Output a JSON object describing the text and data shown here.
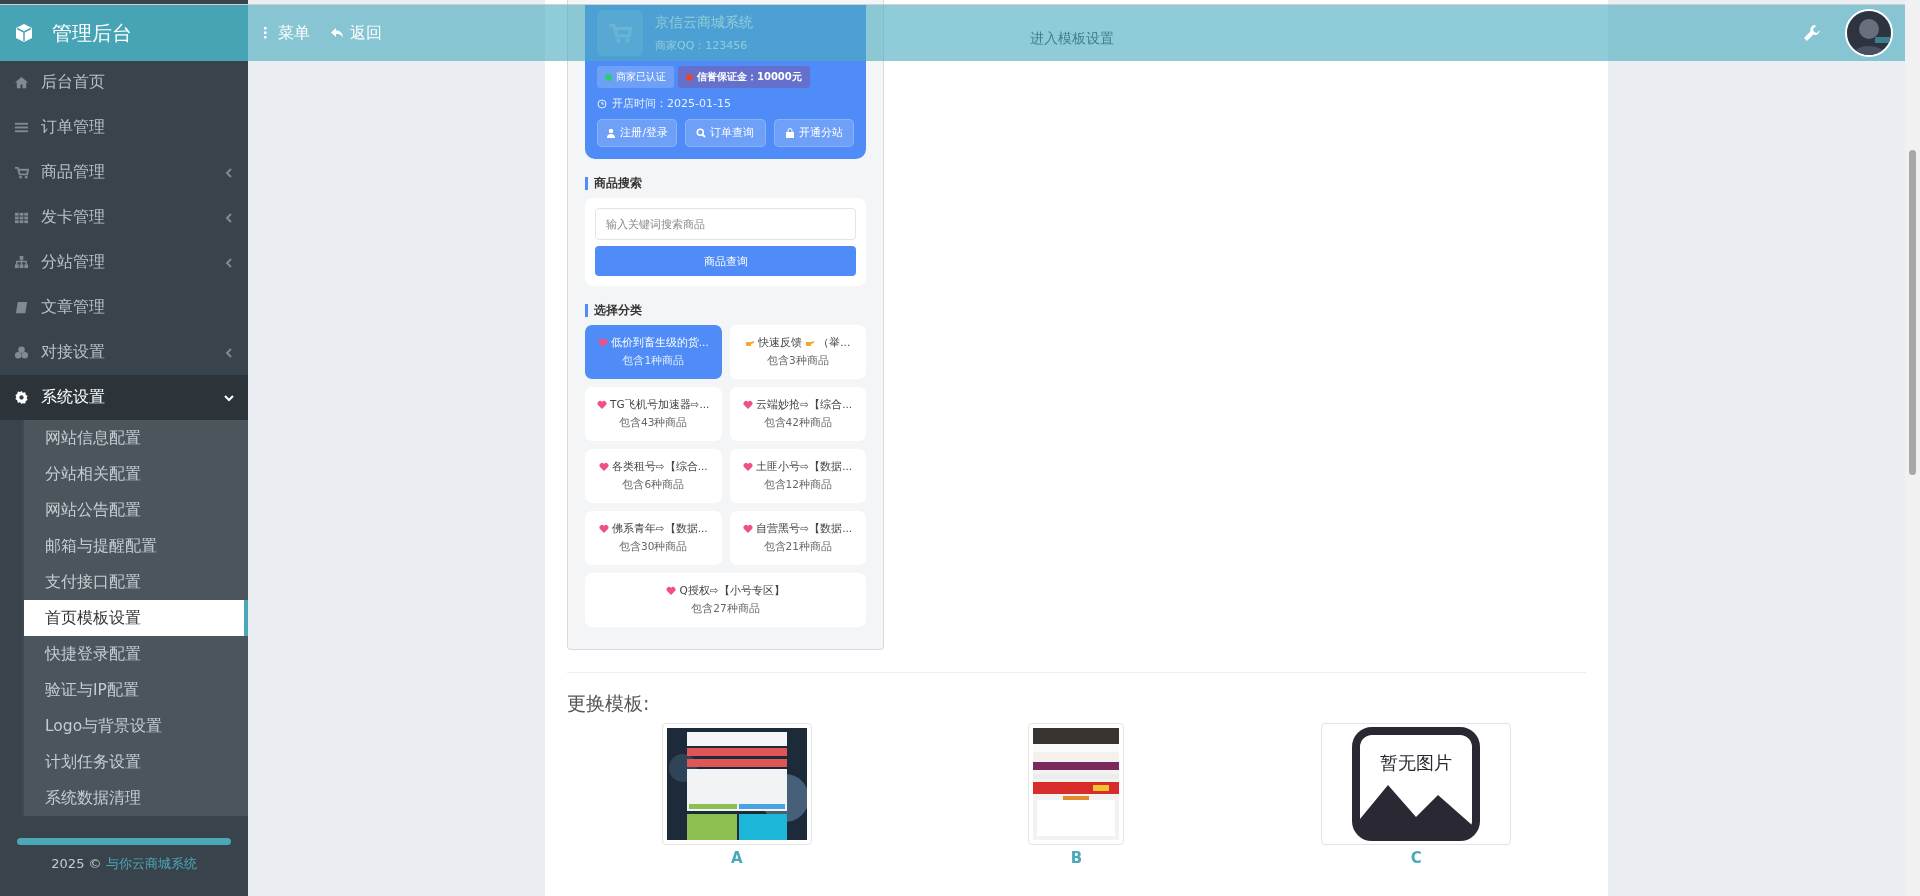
{
  "sidebar": {
    "brand": "管理后台",
    "items": [
      {
        "label": "后台首页",
        "expandable": false,
        "expanded": false
      },
      {
        "label": "订单管理",
        "expandable": false,
        "expanded": false
      },
      {
        "label": "商品管理",
        "expandable": true,
        "expanded": false
      },
      {
        "label": "发卡管理",
        "expandable": true,
        "expanded": false
      },
      {
        "label": "分站管理",
        "expandable": true,
        "expanded": false
      },
      {
        "label": "文章管理",
        "expandable": false,
        "expanded": false
      },
      {
        "label": "对接设置",
        "expandable": true,
        "expanded": false
      },
      {
        "label": "系统设置",
        "expandable": true,
        "expanded": true,
        "children": [
          {
            "label": "网站信息配置",
            "selected": false
          },
          {
            "label": "分站相关配置",
            "selected": false
          },
          {
            "label": "网站公告配置",
            "selected": false
          },
          {
            "label": "邮箱与提醒配置",
            "selected": false
          },
          {
            "label": "支付接口配置",
            "selected": false
          },
          {
            "label": "首页模板设置",
            "selected": true
          },
          {
            "label": "快捷登录配置",
            "selected": false
          },
          {
            "label": "验证与IP配置",
            "selected": false
          },
          {
            "label": "Logo与背景设置",
            "selected": false
          },
          {
            "label": "计划任务设置",
            "selected": false
          },
          {
            "label": "系统数据清理",
            "selected": false
          }
        ]
      }
    ],
    "footer": {
      "year": "2025 ©",
      "link": "与你云商城系统"
    }
  },
  "topbar": {
    "menu": "菜单",
    "back": "返回"
  },
  "preview": {
    "shop_name": "京信云商城系统",
    "shop_qq": "商家QQ：123456",
    "badges": [
      {
        "label": "商家已认证",
        "color": "#2ecc71"
      },
      {
        "label": "信誉保证金：10000元",
        "color": "#e0463c"
      }
    ],
    "open_date": "开店时间：2025-01-15",
    "actions": [
      "注册/登录",
      "订单查询",
      "开通分站"
    ],
    "search_title": "商品搜索",
    "search_placeholder": "输入关键词搜索商品",
    "search_button": "商品查询",
    "category_title": "选择分类",
    "categories": [
      {
        "kind": "heart",
        "name": "低价到畜生级的货...",
        "count": "包含1种商品",
        "selected": true
      },
      {
        "kind": "hand",
        "name": "快速反馈",
        "tail": "（举...",
        "count": "包含3种商品",
        "selected": false
      },
      {
        "kind": "heart",
        "name": "TG飞机号加速器⇨...",
        "count": "包含43种商品",
        "selected": false
      },
      {
        "kind": "heart",
        "name": "云端妙抢⇨【综合...",
        "count": "包含42种商品",
        "selected": false
      },
      {
        "kind": "heart",
        "name": "各类租号⇨【综合...",
        "count": "包含6种商品",
        "selected": false
      },
      {
        "kind": "heart",
        "name": "土匪小号⇨【数据...",
        "count": "包含12种商品",
        "selected": false
      },
      {
        "kind": "heart",
        "name": "佛系青年⇨【数据...",
        "count": "包含30种商品",
        "selected": false
      },
      {
        "kind": "heart",
        "name": "自营黑号⇨【数据...",
        "count": "包含21种商品",
        "selected": false
      },
      {
        "kind": "heart",
        "name": "Q授权⇨【小号专区】",
        "count": "包含27种商品",
        "selected": false
      }
    ]
  },
  "side_text": "进入模板设置",
  "templates": {
    "title": "更换模板:",
    "items": [
      {
        "label": "A",
        "kind": "picture"
      },
      {
        "label": "B",
        "kind": "picture"
      },
      {
        "label": "C",
        "kind": "placeholder",
        "placeholder_text": "暂无图片"
      }
    ]
  }
}
